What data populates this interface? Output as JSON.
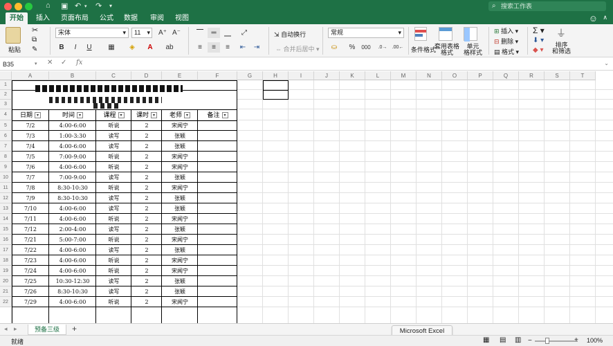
{
  "window": {
    "title": "",
    "search_placeholder": "搜索工作表"
  },
  "tabs": [
    "开始",
    "插入",
    "页面布局",
    "公式",
    "数据",
    "审阅",
    "视图"
  ],
  "ribbon": {
    "paste_label": "粘贴",
    "font_name": "宋体",
    "font_size": "11",
    "bold": "B",
    "italic": "I",
    "underline": "U",
    "wrap_text": "自动换行",
    "merge_center": "合并后居中",
    "number_format": "常规",
    "percent": "%",
    "comma": "000",
    "conditional_format": "条件格式",
    "table_format_line1": "套用表格",
    "table_format_line2": "格式",
    "cell_style_line1": "单元",
    "cell_style_line2": "格样式",
    "insert": "插入",
    "delete": "删除",
    "format": "格式",
    "sort_filter_line1": "排序",
    "sort_filter_line2": "和筛选"
  },
  "formula_bar": {
    "name_box": "B35",
    "fx": "fx",
    "value": ""
  },
  "columns": [
    "A",
    "B",
    "C",
    "D",
    "E",
    "F",
    "G",
    "H",
    "I",
    "J",
    "K",
    "L",
    "M",
    "N",
    "O",
    "P",
    "Q",
    "R",
    "S",
    "T"
  ],
  "rows": [
    "1",
    "2",
    "3",
    "4",
    "5",
    "6",
    "7",
    "8",
    "9",
    "10",
    "11",
    "12",
    "13",
    "14",
    "15",
    "16",
    "17",
    "18",
    "19",
    "20",
    "21",
    "22"
  ],
  "table": {
    "headers": [
      "日期",
      "时间",
      "课程",
      "课时",
      "老师",
      "备注"
    ],
    "data": [
      [
        "7/2",
        "4:00-6:00",
        "听说",
        "2",
        "宋闻宁"
      ],
      [
        "7/3",
        "1:00-3:30",
        "读写",
        "2",
        "张颖"
      ],
      [
        "7/4",
        "4:00-6:00",
        "读写",
        "2",
        "张颖"
      ],
      [
        "7/5",
        "7:00-9:00",
        "听说",
        "2",
        "宋闻宁"
      ],
      [
        "7/6",
        "4:00-6:00",
        "听说",
        "2",
        "宋闻宁"
      ],
      [
        "7/7",
        "7:00-9:00",
        "读写",
        "2",
        "张颖"
      ],
      [
        "7/8",
        "8:30-10:30",
        "听说",
        "2",
        "宋闻宁"
      ],
      [
        "7/9",
        "8:30-10:30",
        "读写",
        "2",
        "张颖"
      ],
      [
        "7/10",
        "4:00-6:00",
        "读写",
        "2",
        "张颖"
      ],
      [
        "7/11",
        "4:00-6:00",
        "听说",
        "2",
        "宋闻宁"
      ],
      [
        "7/12",
        "2:00-4:00",
        "读写",
        "2",
        "张颖"
      ],
      [
        "7/21",
        "5:00-7:00",
        "听说",
        "2",
        "宋闻宁"
      ],
      [
        "7/22",
        "4:00-6:00",
        "读写",
        "2",
        "张颖"
      ],
      [
        "7/23",
        "4:00-6:00",
        "听说",
        "2",
        "宋闻宁"
      ],
      [
        "7/24",
        "4:00-6:00",
        "听说",
        "2",
        "宋闻宁"
      ],
      [
        "7/25",
        "10:30-12:30",
        "读写",
        "2",
        "张颖"
      ],
      [
        "7/26",
        "8:30-10:30",
        "读写",
        "2",
        "张颖"
      ],
      [
        "7/29",
        "4:00-6:00",
        "听说",
        "2",
        "宋闻宁"
      ]
    ]
  },
  "sheet": {
    "tab_name": "预备三级",
    "add": "+"
  },
  "status": {
    "ready": "就绪",
    "zoom": "100%",
    "tooltip": "Microsoft Excel"
  },
  "colors": {
    "brand": "#1e7145",
    "grid": "#e0e0e0"
  }
}
